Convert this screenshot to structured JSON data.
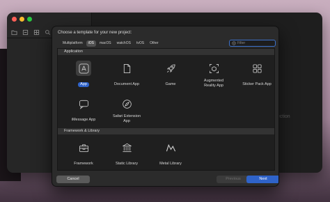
{
  "colors": {
    "accent": "#2f63c9",
    "sheet_bg": "#2b2b2b",
    "content_bg": "#1f1f1f",
    "section_header_bg": "#333333",
    "traffic_red": "#ff5f57",
    "traffic_yellow": "#febc2e",
    "traffic_green": "#28c840"
  },
  "background_window": {
    "partial_text": "ection",
    "toolbar_icons": [
      "folder-icon",
      "source-control-icon",
      "grid-icon",
      "search-icon",
      "warning-icon"
    ]
  },
  "sheet": {
    "title": "Choose a template for your new project:",
    "platform_tabs": [
      {
        "label": "Multiplatform",
        "selected": false
      },
      {
        "label": "iOS",
        "selected": true
      },
      {
        "label": "macOS",
        "selected": false
      },
      {
        "label": "watchOS",
        "selected": false
      },
      {
        "label": "tvOS",
        "selected": false
      },
      {
        "label": "Other",
        "selected": false
      }
    ],
    "filter": {
      "placeholder": "Filter",
      "value": "",
      "icon": "filter-icon"
    },
    "sections": [
      {
        "title": "Application",
        "templates": [
          {
            "label": "App",
            "icon": "app-icon",
            "selected": true
          },
          {
            "label": "Document App",
            "icon": "document-icon",
            "selected": false
          },
          {
            "label": "Game",
            "icon": "rocket-icon",
            "selected": false
          },
          {
            "label": "Augmented\nReality App",
            "icon": "ar-cube-icon",
            "selected": false
          },
          {
            "label": "Sticker Pack App",
            "icon": "sticker-grid-icon",
            "selected": false
          },
          {
            "label": "iMessage App",
            "icon": "message-bubble-icon",
            "selected": false
          },
          {
            "label": "Safari Extension\nApp",
            "icon": "compass-icon",
            "selected": false
          }
        ]
      },
      {
        "title": "Framework & Library",
        "templates": [
          {
            "label": "Framework",
            "icon": "toolbox-icon",
            "selected": false
          },
          {
            "label": "Static Library",
            "icon": "building-columns-icon",
            "selected": false
          },
          {
            "label": "Metal Library",
            "icon": "metal-icon",
            "selected": false
          }
        ]
      }
    ],
    "buttons": {
      "cancel": "Cancel",
      "previous": "Previous",
      "next": "Next"
    }
  }
}
